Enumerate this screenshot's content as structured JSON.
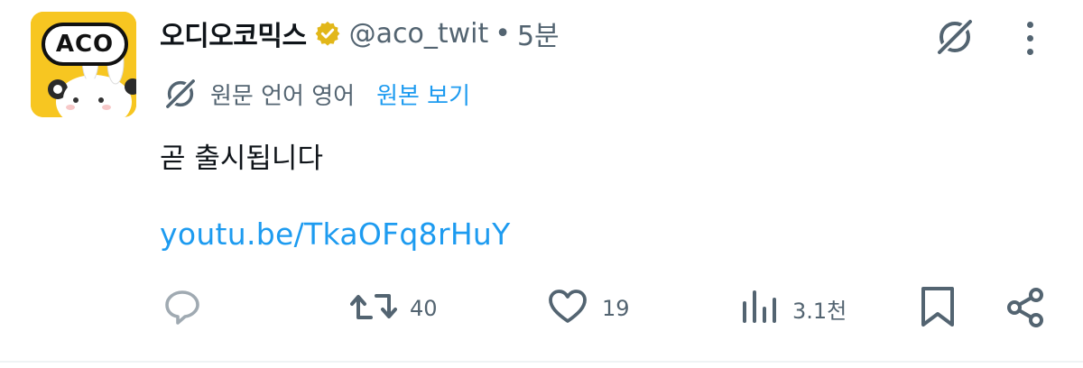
{
  "account": {
    "display_name": "오디오코믹스",
    "handle": "@aco_twit",
    "separator": "•",
    "time": "5분",
    "avatar_text": "ACO",
    "verified": true
  },
  "translation": {
    "original_language": "원문 언어 영어",
    "show_original_label": "원본 보기"
  },
  "tweet": {
    "text": "곧 출시됩니다",
    "link": "youtu.be/TkaOFq8rHuY"
  },
  "actions": {
    "reply_count": "",
    "retweet_count": "40",
    "like_count": "19",
    "view_count": "3.1천"
  },
  "colors": {
    "accent": "#1d9bf0",
    "secondary_text": "#536471",
    "verified_badge": "#e2b719",
    "avatar_bg": "#f7c621"
  },
  "icons": [
    "grok-icon",
    "more-icon",
    "translate-icon",
    "reply-icon",
    "retweet-icon",
    "like-icon",
    "views-icon",
    "bookmark-icon",
    "share-icon",
    "verified-badge-icon"
  ]
}
